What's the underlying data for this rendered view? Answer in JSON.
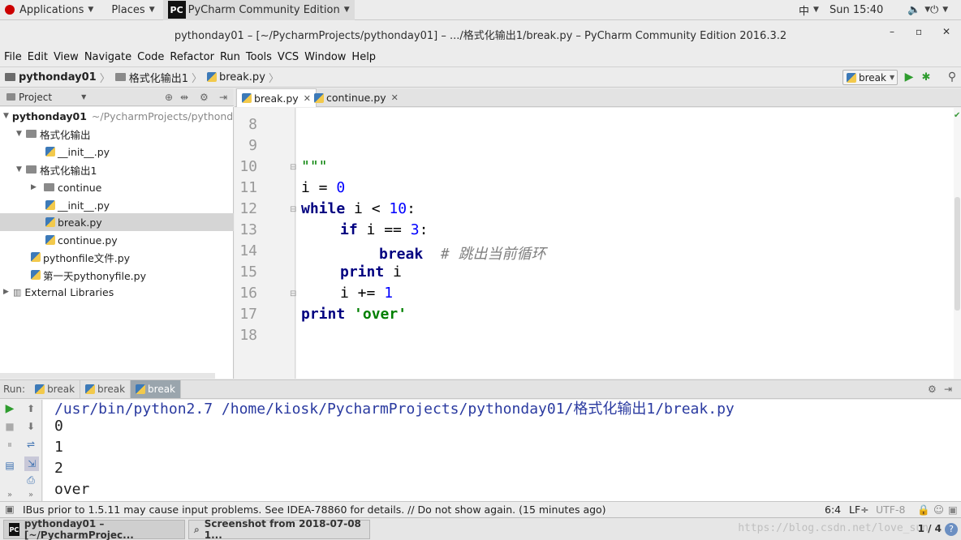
{
  "topbar": {
    "applications": "Applications",
    "places": "Places",
    "app_name": "PyCharm Community Edition",
    "input_method": "中",
    "clock": "Sun 15:40"
  },
  "window": {
    "title": "pythonday01 – [~/PycharmProjects/pythonday01] – .../格式化输出1/break.py – PyCharm Community Edition 2016.3.2"
  },
  "menu": [
    "File",
    "Edit",
    "View",
    "Navigate",
    "Code",
    "Refactor",
    "Run",
    "Tools",
    "VCS",
    "Window",
    "Help"
  ],
  "breadcrumb": [
    "pythonday01",
    "格式化输出1",
    "break.py"
  ],
  "run_config": "break",
  "project_panel": {
    "title": "Project",
    "tree": [
      {
        "label": "pythonday01",
        "detail": "~/PycharmProjects/pythonday",
        "kind": "root",
        "level": 0,
        "expanded": true
      },
      {
        "label": "格式化输出",
        "kind": "folder",
        "level": 1,
        "expanded": true
      },
      {
        "label": "__init__.py",
        "kind": "py",
        "level": 2
      },
      {
        "label": "格式化输出1",
        "kind": "folder",
        "level": 1,
        "expanded": true
      },
      {
        "label": "continue",
        "kind": "folder",
        "level": 2,
        "expanded": false
      },
      {
        "label": "__init__.py",
        "kind": "py",
        "level": 2
      },
      {
        "label": "break.py",
        "kind": "py",
        "level": 2,
        "selected": true
      },
      {
        "label": "continue.py",
        "kind": "py",
        "level": 2
      },
      {
        "label": "pythonfile文件.py",
        "kind": "py",
        "level": 1
      },
      {
        "label": "第一天pythonyfile.py",
        "kind": "py",
        "level": 1
      },
      {
        "label": "External Libraries",
        "kind": "lib",
        "level": 0,
        "expanded": false
      }
    ]
  },
  "editor": {
    "tabs": [
      {
        "label": "break.py",
        "active": true
      },
      {
        "label": "continue.py",
        "active": false
      }
    ],
    "line_numbers": [
      "8",
      "9",
      "10",
      "11",
      "12",
      "13",
      "14",
      "15",
      "16",
      "17",
      "18"
    ],
    "code": {
      "l10": "\"\"\"",
      "l11_var": "i",
      "l11_op": " = ",
      "l11_num": "0",
      "l12_kw": "while",
      "l12_mid": " i < ",
      "l12_num": "10",
      "l12_end": ":",
      "l13_kw": "if",
      "l13_mid": " i == ",
      "l13_num": "3",
      "l13_end": ":",
      "l14_kw": "break",
      "l14_cmt": "# 跳出当前循环",
      "l15_kw": "print",
      "l15_arg": " i",
      "l16_mid": "i += ",
      "l16_num": "1",
      "l17_kw": "print",
      "l17_str": "'over'"
    }
  },
  "run_panel": {
    "label": "Run:",
    "tabs": [
      "break",
      "break",
      "break"
    ],
    "output": [
      "/usr/bin/python2.7 /home/kiosk/PycharmProjects/pythonday01/格式化输出1/break.py",
      "0",
      "1",
      "2",
      "over"
    ]
  },
  "statusbar": {
    "message": "IBus prior to 1.5.11 may cause input problems. See IDEA-78860 for details. // Do not show again. (15 minutes ago)",
    "position": "6:4",
    "line_sep": "LF÷",
    "encoding": "UTF-8"
  },
  "taskbar": {
    "items": [
      "pythonday01 – [~/PycharmProjec...",
      "Screenshot from 2018-07-08 1..."
    ],
    "watermark": "https://blog.csdn.net/love_sun",
    "pager": "1 / 4"
  }
}
